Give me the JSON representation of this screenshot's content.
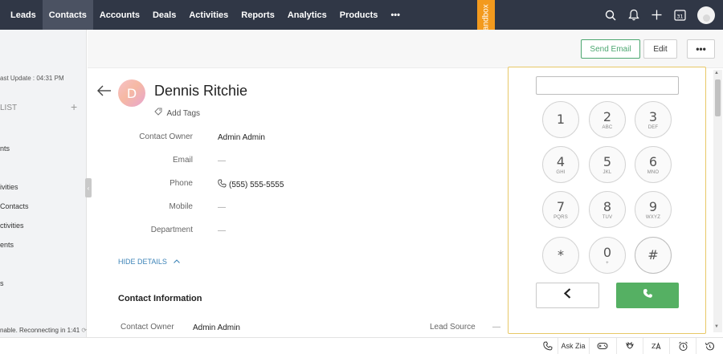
{
  "topnav": {
    "tabs": [
      {
        "label": "Leads"
      },
      {
        "label": "Contacts"
      },
      {
        "label": "Accounts"
      },
      {
        "label": "Deals"
      },
      {
        "label": "Activities"
      },
      {
        "label": "Reports"
      },
      {
        "label": "Analytics"
      },
      {
        "label": "Products"
      },
      {
        "label": "•••"
      }
    ],
    "active_tab": "Contacts",
    "sandbox_label": "Sandbox",
    "calendar_day": "31",
    "icons": [
      "search-icon",
      "bell-icon",
      "plus-icon",
      "calendar-icon",
      "profile-avatar"
    ]
  },
  "sidebar": {
    "last_update": "ast Update : 04:31 PM",
    "list_header": "LIST",
    "items": [
      "nts",
      "ivities",
      "Contacts",
      "ctivities",
      "ents",
      "s"
    ],
    "status": "nable. Reconnecting in 1:41"
  },
  "actions": {
    "send_email": "Send Email",
    "edit": "Edit",
    "more": "•••"
  },
  "contact": {
    "initial": "D",
    "name": "Dennis Ritchie",
    "add_tags": "Add Tags",
    "fields": [
      {
        "label": "Contact Owner",
        "value": "Admin Admin"
      },
      {
        "label": "Email",
        "value": "—"
      },
      {
        "label": "Phone",
        "value": "(555) 555-5555"
      },
      {
        "label": "Mobile",
        "value": "—"
      },
      {
        "label": "Department",
        "value": "—"
      }
    ],
    "hide_details": "HIDE DETAILS",
    "section_title": "Contact Information",
    "info": {
      "owner_label": "Contact Owner",
      "owner_value": "Admin Admin",
      "lead_source_label": "Lead Source",
      "lead_source_value": "—"
    }
  },
  "dialer": {
    "input_value": "",
    "keys": [
      {
        "num": "1",
        "letters": ""
      },
      {
        "num": "2",
        "letters": "ABC"
      },
      {
        "num": "3",
        "letters": "DEF"
      },
      {
        "num": "4",
        "letters": "GHI"
      },
      {
        "num": "5",
        "letters": "JKL"
      },
      {
        "num": "6",
        "letters": "MNO"
      },
      {
        "num": "7",
        "letters": "PQRS"
      },
      {
        "num": "8",
        "letters": "TUV"
      },
      {
        "num": "9",
        "letters": "WXYZ"
      },
      {
        "num": "*",
        "letters": ""
      },
      {
        "num": "0",
        "letters": "+"
      },
      {
        "num": "#",
        "letters": ""
      }
    ],
    "back_icon": "chevron-left-icon",
    "call_icon": "phone-icon",
    "call_color": "#55b063"
  },
  "bottombar": {
    "ask_zia": "Ask Zia",
    "icons": [
      "phone-icon",
      "gamepad-icon",
      "bird-icon",
      "translate-icon",
      "alarm-icon",
      "history-icon"
    ]
  },
  "colors": {
    "nav_bg": "#303746",
    "accent_green": "#4ca770",
    "sandbox_orange": "#f39a1e",
    "dialer_border": "#e8c867",
    "link_blue": "#3c83b7"
  }
}
